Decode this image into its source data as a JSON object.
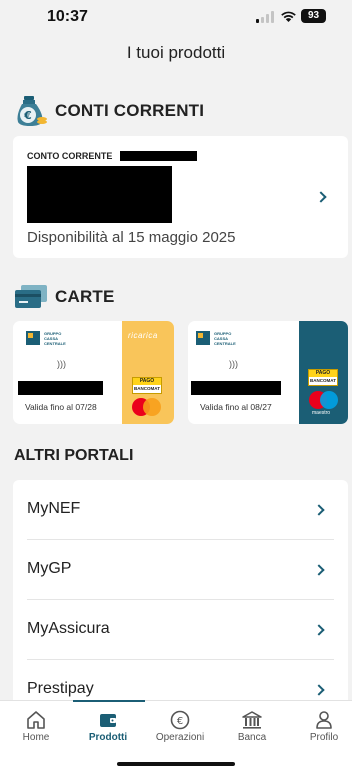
{
  "status_bar": {
    "time": "10:37",
    "battery": "93"
  },
  "page": {
    "title": "I tuoi prodotti"
  },
  "sections": {
    "accounts": {
      "title": "CONTI CORRENTI"
    },
    "cards": {
      "title": "CARTE"
    },
    "portals": {
      "title": "ALTRI PORTALI"
    }
  },
  "account": {
    "type_label": "CONTO CORRENTE",
    "availability": "Disponibilità al 15 maggio 2025"
  },
  "cards": [
    {
      "bank_lines": [
        "GRUPPO",
        "CASSA",
        "CENTRALE"
      ],
      "validity": "Valida fino al 07/28",
      "stripe_text": "ricarica",
      "stripe_color": "#f9c55a",
      "circuit": "mastercard",
      "pago_top": "PAGO",
      "pago_bottom": "BANCOMAT"
    },
    {
      "bank_lines": [
        "GRUPPO",
        "CASSA",
        "CENTRALE"
      ],
      "validity": "Valida fino al 08/27",
      "stripe_text": "",
      "stripe_color": "#1b5e75",
      "circuit": "maestro",
      "circuit_label": "maestro",
      "pago_top": "PAGO",
      "pago_bottom": "BANCOMAT"
    }
  ],
  "portals": [
    "MyNEF",
    "MyGP",
    "MyAssicura",
    "Prestipay"
  ],
  "tab_bar": {
    "items": [
      {
        "label": "Home",
        "icon": "home-icon"
      },
      {
        "label": "Prodotti",
        "icon": "wallet-icon"
      },
      {
        "label": "Operazioni",
        "icon": "euro-icon"
      },
      {
        "label": "Banca",
        "icon": "bank-icon"
      },
      {
        "label": "Profilo",
        "icon": "user-icon"
      }
    ],
    "active": "Prodotti"
  },
  "colors": {
    "accent": "#1b5e75",
    "background": "#f2f2f2",
    "card_yellow": "#f9c55a"
  }
}
